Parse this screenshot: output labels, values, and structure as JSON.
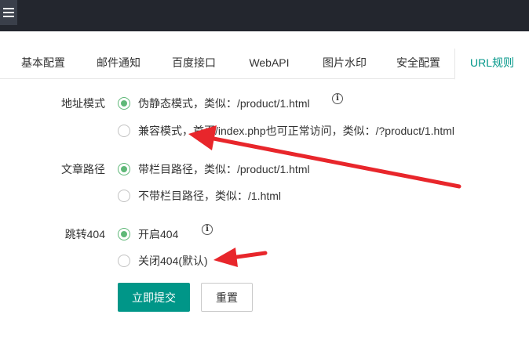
{
  "header": {
    "menu_icon": "hamburger-icon"
  },
  "tabs": [
    {
      "label": "基本配置"
    },
    {
      "label": "邮件通知"
    },
    {
      "label": "百度接口"
    },
    {
      "label": "WebAPI"
    },
    {
      "label": "图片水印"
    },
    {
      "label": "安全配置"
    },
    {
      "label": "URL规则",
      "active": true
    }
  ],
  "form": {
    "address_mode": {
      "label": "地址模式",
      "options": [
        "伪静态模式，类似：/product/1.html",
        "兼容模式，首页/index.php也可正常访问，类似：/?product/1.html"
      ],
      "selected": 0
    },
    "article_path": {
      "label": "文章路径",
      "options": [
        "带栏目路径，类似：/product/1.html",
        "不带栏目路径，类似：/1.html"
      ],
      "selected": 0
    },
    "redirect_404": {
      "label": "跳转404",
      "options": [
        "开启404",
        "关闭404(默认)"
      ],
      "selected": 0
    },
    "info_icon_text": "i"
  },
  "buttons": {
    "submit": "立即提交",
    "reset": "重置"
  },
  "colors": {
    "accent": "#009688",
    "radio": "#5fb878",
    "arrow": "#e8262b"
  }
}
